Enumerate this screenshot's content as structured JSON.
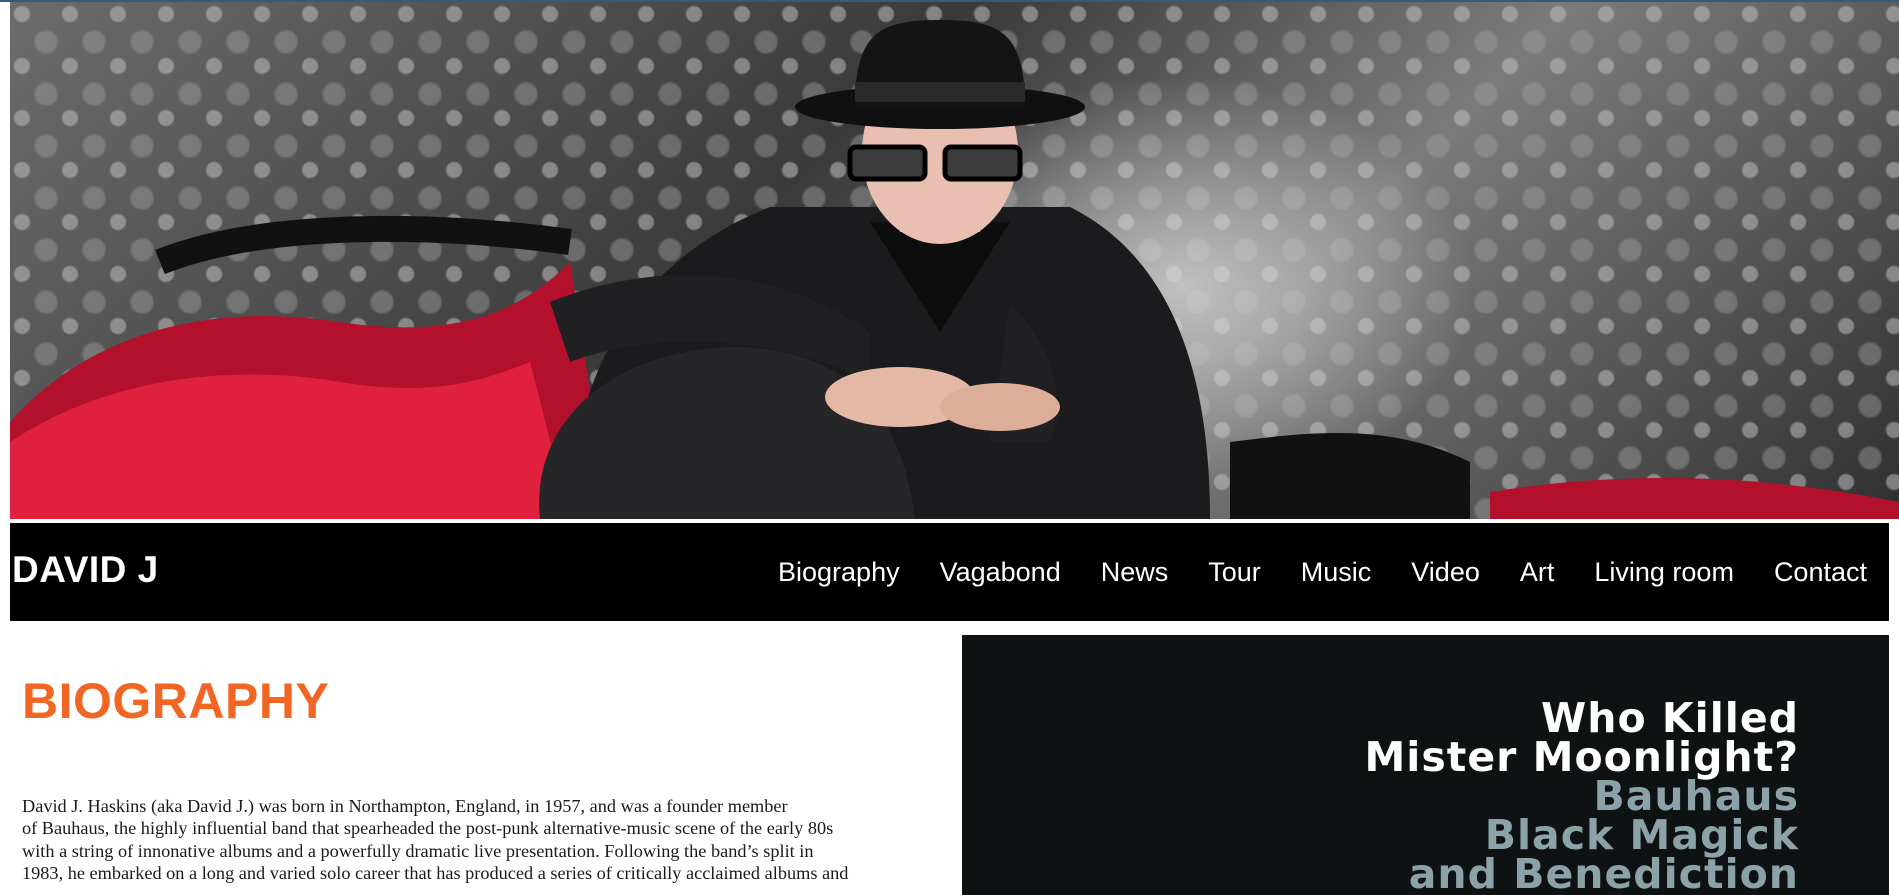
{
  "site": {
    "brand": "DAVID J"
  },
  "nav": {
    "items": [
      {
        "label": "Biography"
      },
      {
        "label": "Vagabond"
      },
      {
        "label": "News"
      },
      {
        "label": "Tour"
      },
      {
        "label": "Music"
      },
      {
        "label": "Video"
      },
      {
        "label": "Art"
      },
      {
        "label": "Living room"
      },
      {
        "label": "Contact"
      }
    ]
  },
  "main": {
    "title": "BIOGRAPHY",
    "bio_lines": [
      "David J. Haskins (aka David J.) was born in Northampton, England, in 1957, and was a founder member",
      "of Bauhaus, the highly influential band that spearheaded the post-punk alternative-music scene of the early 80s",
      "with a string of innonative albums and a powerfully dramatic live presentation. Following the band’s split in",
      "1983, he embarked on a long and varied solo career that has produced a series of critically acclaimed albums and"
    ]
  },
  "album": {
    "lines": [
      {
        "text": "Who Killed",
        "color": "white"
      },
      {
        "text": "Mister Moonlight?",
        "color": "white"
      },
      {
        "text": "Bauhaus",
        "color": "slate"
      },
      {
        "text": "Black Magick",
        "color": "slate"
      },
      {
        "text": "and Benediction",
        "color": "slate"
      }
    ]
  },
  "colors": {
    "accent": "#f26522",
    "navbar": "#000000",
    "album_bg": "#0f1212",
    "album_subtitle": "#8ba3a8"
  }
}
